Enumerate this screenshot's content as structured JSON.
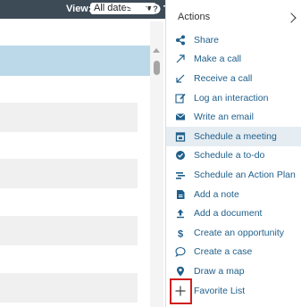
{
  "toolbar": {
    "view_label": "View:",
    "view_value": "All dates"
  },
  "panel": {
    "title": "Actions",
    "items": [
      {
        "label": "Share",
        "icon": "share-icon"
      },
      {
        "label": "Make a call",
        "icon": "outgoing-call-icon"
      },
      {
        "label": "Receive a call",
        "icon": "incoming-call-icon"
      },
      {
        "label": "Log an interaction",
        "icon": "edit-icon"
      },
      {
        "label": "Write an email",
        "icon": "email-icon"
      },
      {
        "label": "Schedule a meeting",
        "icon": "calendar-icon",
        "selected": true
      },
      {
        "label": "Schedule a to-do",
        "icon": "check-circle-icon"
      },
      {
        "label": "Schedule an Action Plan",
        "icon": "action-plan-icon"
      },
      {
        "label": "Add a note",
        "icon": "note-icon"
      },
      {
        "label": "Add a document",
        "icon": "upload-icon"
      },
      {
        "label": "Create an opportunity",
        "icon": "dollar-icon"
      },
      {
        "label": "Create a case",
        "icon": "chat-icon"
      },
      {
        "label": "Draw a map",
        "icon": "map-pin-icon"
      },
      {
        "label": "Favorite List",
        "icon": "plus-icon"
      }
    ]
  },
  "colors": {
    "topbar": "#3d4b57",
    "link": "#1f5f8b",
    "highlight_border": "#d11f1f",
    "selected_row": "#e6edf2",
    "first_row": "#bcd9ea"
  }
}
